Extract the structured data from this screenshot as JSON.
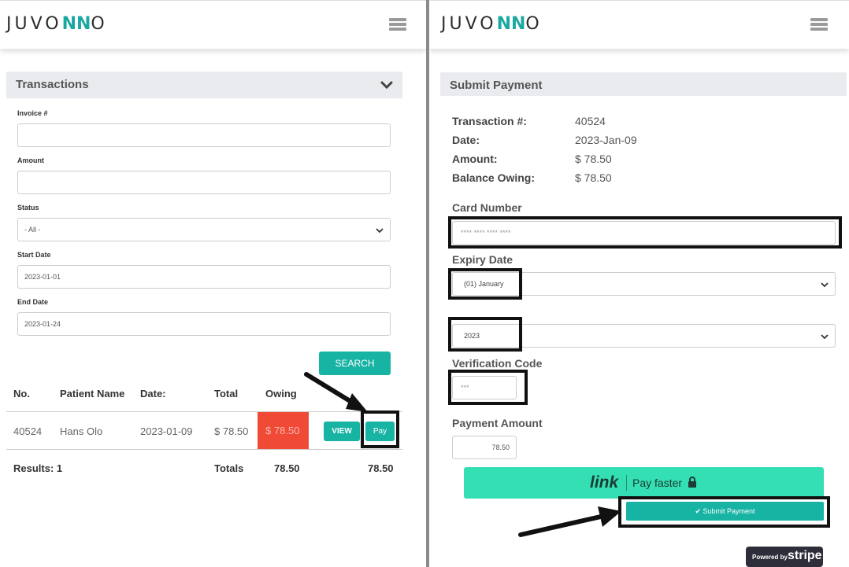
{
  "left": {
    "logo": {
      "pre": "JUVO",
      "mid": "NN",
      "post": "O"
    },
    "section_title": "Transactions",
    "fields": {
      "invoice_label": "Invoice #",
      "invoice_value": "",
      "amount_label": "Amount",
      "amount_value": "",
      "status_label": "Status",
      "status_value": "- All -",
      "start_label": "Start Date",
      "start_value": "2023-01-01",
      "end_label": "End Date",
      "end_value": "2023-01-24"
    },
    "search_label": "SEARCH",
    "table": {
      "headers": [
        "No.",
        "Patient Name",
        "Date:",
        "Total",
        "Owing"
      ],
      "rows": [
        {
          "no": "40524",
          "patient": "Hans Olo",
          "date": "2023-01-09",
          "total": "$ 78.50",
          "owing": "$ 78.50"
        }
      ],
      "view_label": "VIEW",
      "pay_label": "Pay",
      "results_label": "Results: 1",
      "totals_label": "Totals",
      "totals_total": "78.50",
      "totals_owing": "78.50"
    }
  },
  "right": {
    "logo": {
      "pre": "JUVO",
      "mid": "NN",
      "post": "O"
    },
    "header_title": "Submit Payment",
    "info": {
      "transaction_label": "Transaction #:",
      "transaction_value": "40524",
      "date_label": "Date:",
      "date_value": "2023-Jan-09",
      "amount_label": "Amount:",
      "amount_value": "$ 78.50",
      "balance_label": "Balance Owing:",
      "balance_value": "$ 78.50"
    },
    "card_number_label": "Card Number",
    "card_number_placeholder": "**** **** **** ****",
    "expiry_label": "Expiry Date",
    "expiry_month": "(01) January",
    "expiry_year": "2023",
    "cvc_label": "Verification Code",
    "cvc_placeholder": "***",
    "payment_amount_label": "Payment Amount",
    "payment_amount_value": "78.50",
    "link_word": "link",
    "link_text": "Pay faster",
    "submit_label": "✔ Submit Payment",
    "stripe_small": "Powered by",
    "stripe_word": "stripe"
  },
  "colors": {
    "accent": "#17b3a3",
    "owing_bg": "#f04a37",
    "link_bg": "#33dfb3",
    "header_bg": "#e9ebee"
  }
}
